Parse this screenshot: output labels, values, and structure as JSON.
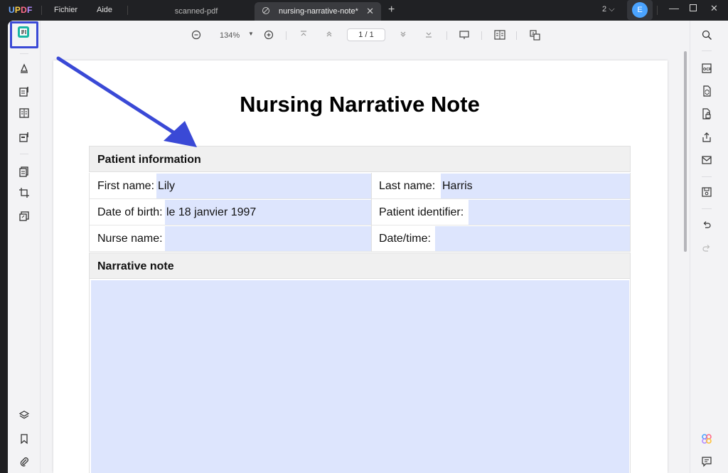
{
  "app": {
    "logo": "UPDF"
  },
  "menu": {
    "file": "Fichier",
    "help": "Aide"
  },
  "tabs": [
    {
      "label": "scanned-pdf",
      "active": false
    },
    {
      "label": "nursing-narrative-note*",
      "active": true
    }
  ],
  "window": {
    "count": "2",
    "avatar_initial": "E"
  },
  "toolbar": {
    "zoom": "134%",
    "page": "1 / 1"
  },
  "document": {
    "title": "Nursing Narrative Note",
    "sections": {
      "patient_info": "Patient information",
      "narrative": "Narrative note"
    },
    "fields": {
      "first_name_label": "First name:",
      "first_name_value": "Lily",
      "last_name_label": "Last name:",
      "last_name_value": "Harris",
      "dob_label": "Date of birth:",
      "dob_value": "le 18 janvier 1997",
      "patient_id_label": "Patient identifier:",
      "patient_id_value": "",
      "nurse_label": "Nurse name:",
      "nurse_value": "",
      "datetime_label": "Date/time:",
      "datetime_value": ""
    }
  },
  "colors": {
    "accent": "#3a49d6",
    "field_fill": "#dde5fd",
    "titlebar": "#202124"
  }
}
